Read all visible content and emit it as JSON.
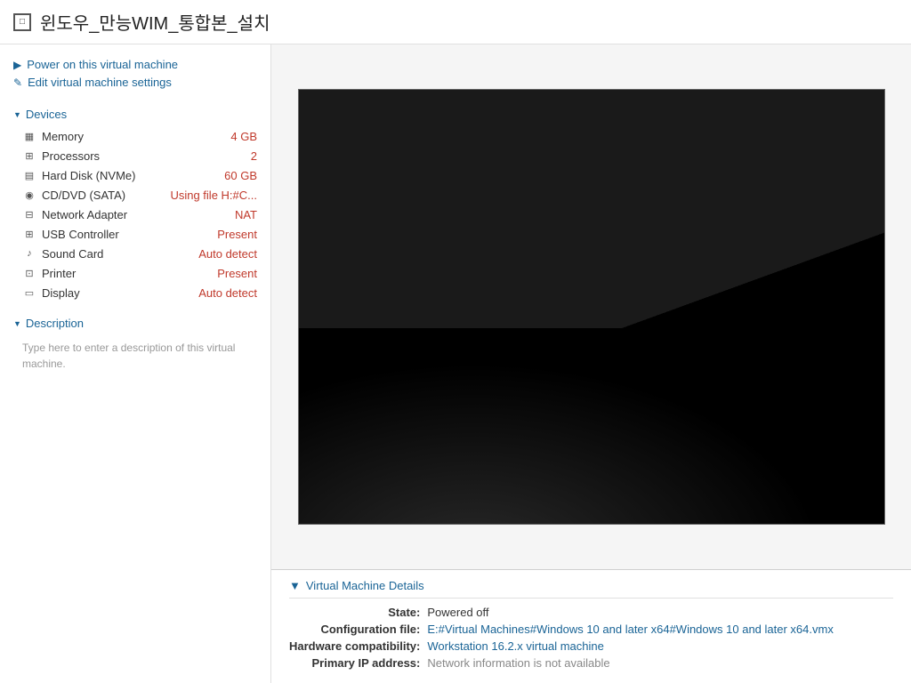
{
  "title": {
    "icon_label": "□",
    "text": "윈도우_만능WIM_통합본_설치"
  },
  "sidebar": {
    "actions": [
      {
        "id": "power-on",
        "icon": "▶",
        "label": "Power on this virtual machine"
      },
      {
        "id": "edit-settings",
        "icon": "✎",
        "label": "Edit virtual machine settings"
      }
    ],
    "devices_section": {
      "label": "Devices",
      "items": [
        {
          "id": "memory",
          "icon": "▦",
          "name": "Memory",
          "value": "4 GB"
        },
        {
          "id": "processors",
          "icon": "⊞",
          "name": "Processors",
          "value": "2"
        },
        {
          "id": "hard-disk",
          "icon": "▤",
          "name": "Hard Disk (NVMe)",
          "value": "60 GB"
        },
        {
          "id": "cddvd",
          "icon": "◉",
          "name": "CD/DVD (SATA)",
          "value": "Using file H:#C..."
        },
        {
          "id": "network",
          "icon": "⊟",
          "name": "Network Adapter",
          "value": "NAT"
        },
        {
          "id": "usb",
          "icon": "⊞",
          "name": "USB Controller",
          "value": "Present"
        },
        {
          "id": "sound",
          "icon": "♪",
          "name": "Sound Card",
          "value": "Auto detect"
        },
        {
          "id": "printer",
          "icon": "⊡",
          "name": "Printer",
          "value": "Present"
        },
        {
          "id": "display",
          "icon": "▭",
          "name": "Display",
          "value": "Auto detect"
        }
      ]
    },
    "description_section": {
      "label": "Description",
      "placeholder": "Type here to enter a description of this virtual machine."
    }
  },
  "vm_details": {
    "section_label": "Virtual Machine Details",
    "rows": [
      {
        "label": "State:",
        "value": "Powered off",
        "style": "normal"
      },
      {
        "label": "Configuration file:",
        "value": "E:#Virtual Machines#Windows 10 and later x64#Windows 10 and later x64.vmx",
        "style": "link"
      },
      {
        "label": "Hardware compatibility:",
        "value": "Workstation 16.2.x virtual machine",
        "style": "link"
      },
      {
        "label": "Primary IP address:",
        "value": "Network information is not available",
        "style": "gray"
      }
    ]
  }
}
